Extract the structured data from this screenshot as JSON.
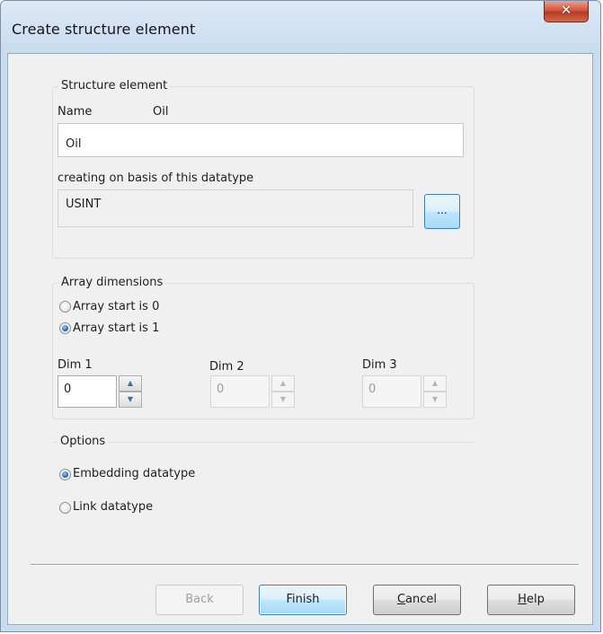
{
  "window": {
    "title": "Create structure element",
    "close_glyph": "✕"
  },
  "structure_group": {
    "title": "Structure element",
    "name_label": "Name",
    "name_display": "Oil",
    "name_value": "Oil",
    "basis_label": "creating on basis of this datatype",
    "datatype_value": "USINT",
    "browse_label": "..."
  },
  "array_group": {
    "title": "Array dimensions",
    "options": [
      {
        "label": "Array start is 0",
        "checked": false
      },
      {
        "label": "Array start is 1",
        "checked": true
      }
    ],
    "dims": [
      {
        "label": "Dim 1",
        "value": "0",
        "enabled": true
      },
      {
        "label": "Dim 2",
        "value": "0",
        "enabled": false
      },
      {
        "label": "Dim 3",
        "value": "0",
        "enabled": false
      }
    ],
    "spin_up_glyph": "▲",
    "spin_down_glyph": "▼"
  },
  "options_group": {
    "title": "Options",
    "options": [
      {
        "label": "Embedding datatype",
        "checked": true
      },
      {
        "label": "Link datatype",
        "checked": false
      }
    ]
  },
  "buttons": {
    "back": "Back",
    "finish": "Finish",
    "cancel_accel": "C",
    "cancel_rest": "ancel",
    "help_accel": "H",
    "help_rest": "elp"
  },
  "colors": {
    "accent_blue": "#3c7fb1",
    "close_red": "#c8472d",
    "dialog_bg": "#f0f0f0"
  }
}
